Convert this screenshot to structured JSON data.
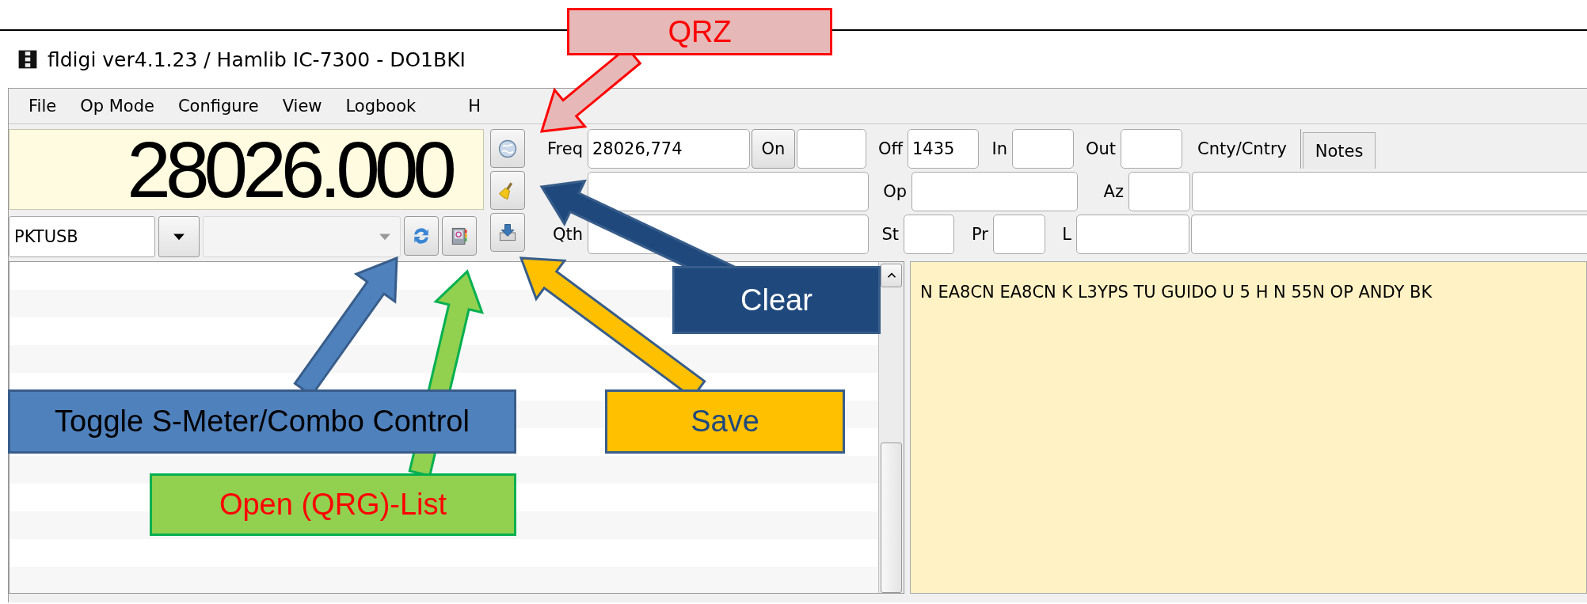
{
  "window": {
    "title": "fldigi ver4.1.23 / Hamlib IC-7300 - DO1BKI"
  },
  "menu": [
    {
      "label": "File"
    },
    {
      "label": "Op Mode"
    },
    {
      "label": "Configure"
    },
    {
      "label": "View"
    },
    {
      "label": "Logbook"
    },
    {
      "label": "H"
    }
  ],
  "frequency_display": "28026.000",
  "mode_select": {
    "value": "PKTUSB",
    "disabled": false
  },
  "bandwidth_select": {
    "disabled": true
  },
  "logbook": {
    "line_freq": [
      {
        "kind": "label",
        "text": "Freq"
      },
      {
        "kind": "field",
        "value": "28026,774"
      },
      {
        "kind": "button",
        "label": "On"
      },
      {
        "kind": "field"
      },
      {
        "kind": "label",
        "text": "Off"
      },
      {
        "kind": "field",
        "value": "1435"
      },
      {
        "kind": "label",
        "text": "In"
      },
      {
        "kind": "field"
      },
      {
        "kind": "label",
        "text": "Out"
      },
      {
        "kind": "field"
      },
      {
        "kind": "tab",
        "label": "Cnty/Cntry",
        "selected": true
      },
      {
        "kind": "tab",
        "label": "Notes",
        "selected": false
      }
    ],
    "line_op": [
      {
        "kind": "field"
      },
      {
        "kind": "label",
        "text": "Op"
      },
      {
        "kind": "field"
      },
      {
        "kind": "label",
        "text": "Az"
      },
      {
        "kind": "field"
      },
      {
        "kind": "field"
      }
    ],
    "line_qth": [
      {
        "kind": "label",
        "text": "Qth"
      },
      {
        "kind": "field"
      },
      {
        "kind": "label",
        "text": "St"
      },
      {
        "kind": "field"
      },
      {
        "kind": "label",
        "text": "Pr"
      },
      {
        "kind": "field"
      },
      {
        "kind": "label",
        "text": "L"
      },
      {
        "kind": "field"
      },
      {
        "kind": "field"
      }
    ]
  },
  "receive_text": "N EA8CN EA8CN K L3YPS TU GUIDO U 5 H N 55N OP ANDY BK",
  "callouts": [
    {
      "label": "QRZ",
      "color": "#e6b9b8"
    },
    {
      "label": "Clear",
      "color": "#1f497d"
    },
    {
      "label": "Toggle S-Meter/Combo Control",
      "color": "#4f81bd"
    },
    {
      "label": "Save",
      "color": "#ffc000"
    },
    {
      "label": "Open (QRG)-List",
      "color": "#92d050"
    }
  ]
}
